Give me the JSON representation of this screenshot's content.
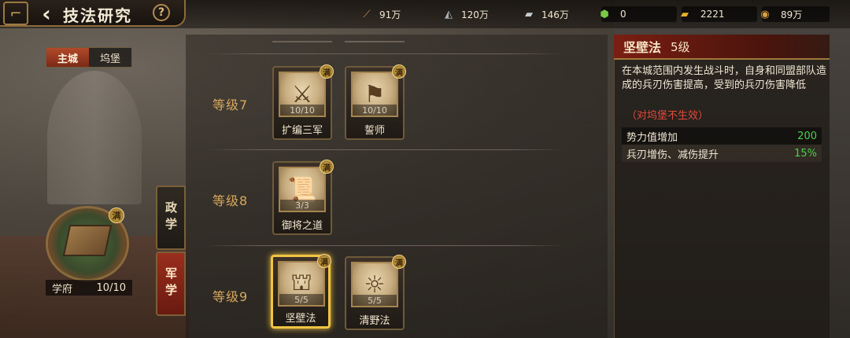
{
  "header": {
    "title": "技法研究",
    "back_icon": "back-arrow-icon",
    "help_label": "?"
  },
  "resources": [
    {
      "icon": "wood-icon",
      "value": "91万"
    },
    {
      "icon": "iron-icon",
      "value": "120万"
    },
    {
      "icon": "stone-icon",
      "value": "146万"
    },
    {
      "icon": "jade-icon",
      "value": "0"
    },
    {
      "icon": "gold-bar-icon",
      "value": "2221"
    },
    {
      "icon": "copper-coin-icon",
      "value": "89万"
    }
  ],
  "city_toggle": {
    "options": [
      "主城",
      "坞堡"
    ],
    "selected": "主城"
  },
  "side_tabs": [
    {
      "label": "政学",
      "active": false
    },
    {
      "label": "军学",
      "active": true
    }
  ],
  "academy": {
    "badge": "满",
    "name": "学府",
    "level": "10/10"
  },
  "levels": [
    {
      "label": "等级7",
      "skills": [
        {
          "name": "扩编三军",
          "progress": "10/10",
          "badge": "满",
          "icon": "warrior-art-icon",
          "selected": false
        },
        {
          "name": "誓师",
          "progress": "10/10",
          "badge": "满",
          "icon": "banner-art-icon",
          "selected": false
        }
      ]
    },
    {
      "label": "等级8",
      "skills": [
        {
          "name": "御将之道",
          "progress": "3/3",
          "badge": "满",
          "icon": "scroll-art-icon",
          "selected": false
        }
      ]
    },
    {
      "label": "等级9",
      "skills": [
        {
          "name": "坚壁法",
          "progress": "5/5",
          "badge": "满",
          "icon": "fortress-art-icon",
          "selected": true
        },
        {
          "name": "清野法",
          "progress": "5/5",
          "badge": "满",
          "icon": "sage-art-icon",
          "selected": false
        }
      ]
    }
  ],
  "detail": {
    "title": "坚壁法",
    "level": "5级",
    "description": "在本城范围内发生战斗时，自身和同盟部队造成的兵刃伤害提高，受到的兵刃伤害降低",
    "note": "（对坞堡不生效）",
    "stats": [
      {
        "label": "势力值增加",
        "value": "200"
      },
      {
        "label": "兵刃增伤、减伤提升",
        "value": "15%"
      }
    ]
  },
  "colors": {
    "accent_gold": "#f0c442",
    "level_label": "#d9a85c",
    "stat_value": "#4cd04c",
    "note_red": "#e04a3a",
    "active_tab": "#9a2e1e"
  }
}
